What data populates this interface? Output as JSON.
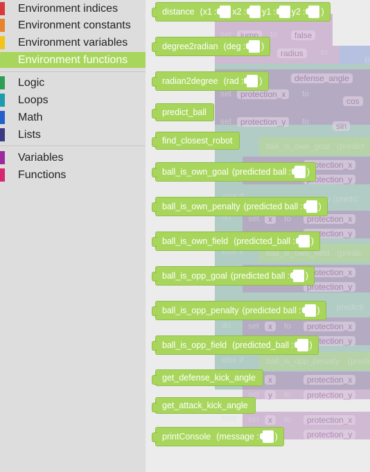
{
  "toolbox": {
    "categories": [
      {
        "label": "Environment indices",
        "color": "#d73a3a"
      },
      {
        "label": "Environment constants",
        "color": "#e8852a"
      },
      {
        "label": "Environment variables",
        "color": "#f0c419"
      },
      {
        "label": "Environment functions",
        "color": "#a8d65d"
      },
      {
        "label": "Logic",
        "color": "#2e9e57"
      },
      {
        "label": "Loops",
        "color": "#1f9bb0"
      },
      {
        "label": "Math",
        "color": "#2460c9"
      },
      {
        "label": "Lists",
        "color": "#3c3a80"
      },
      {
        "label": "Variables",
        "color": "#9c2a9c"
      },
      {
        "label": "Functions",
        "color": "#d62770"
      }
    ],
    "selected": "Environment functions"
  },
  "flyout": {
    "blocks": [
      {
        "name": "distance",
        "params": [
          "x1",
          "x2",
          "y1",
          "y2"
        ]
      },
      {
        "name": "degree2radian",
        "params": [
          "deg"
        ]
      },
      {
        "name": "radian2degree",
        "params": [
          "rad"
        ]
      },
      {
        "name": "predict_ball",
        "params": []
      },
      {
        "name": "find_closest_robot",
        "params": []
      },
      {
        "name": "ball_is_own_goal",
        "params": [
          "predicted ball"
        ]
      },
      {
        "name": "ball_is_own_penalty",
        "params": [
          "predicted ball"
        ]
      },
      {
        "name": "ball_is_own_field",
        "params": [
          "predicted_ball"
        ]
      },
      {
        "name": "ball_is_opp_goal",
        "params": [
          "predicted ball"
        ]
      },
      {
        "name": "ball_is_opp_penalty",
        "params": [
          "predicted ball"
        ]
      },
      {
        "name": "ball_is_opp_field",
        "params": [
          "predicted_ball"
        ]
      },
      {
        "name": "get_defense_kick_angle",
        "params": []
      },
      {
        "name": "get_attack_kick_angle",
        "params": []
      },
      {
        "name": "printConsole",
        "params": [
          "message"
        ]
      }
    ]
  },
  "workspace": {
    "bg_labels": {
      "set": "set",
      "to": "to",
      "jump": "jump",
      "false": "false",
      "radius": "radius",
      "defense_angle": "defense_angle",
      "protection_x": "protection_x",
      "protection_y": "protection_y",
      "cos": "cos",
      "sin": "sin",
      "else_if": "else if",
      "do": "do",
      "else": "else",
      "x": "x",
      "y": "y",
      "ball_is_own_goal": "ball_is_own_goal",
      "ball_is_own_field": "ball_is_own_field",
      "ball_is_opp_penalty": "ball_is_opp_penalty",
      "predict": "(predict",
      "prediction_partial": "(predicti",
      "predic_partial": "(predic",
      "predicti_partial": "predicti",
      "ty_predic": "ty (predic",
      "b": "B"
    }
  }
}
